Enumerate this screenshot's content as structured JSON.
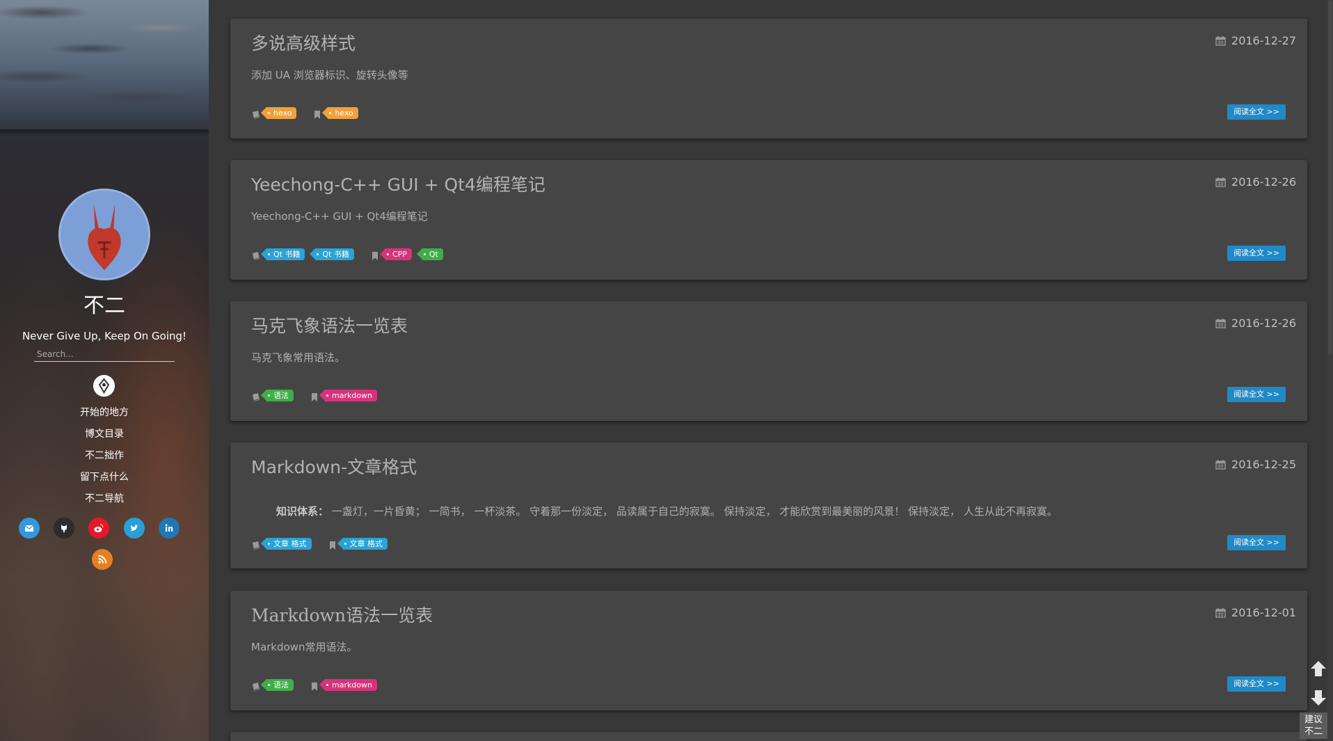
{
  "site": {
    "name": "不二",
    "motto": "Never Give Up, Keep On Going!",
    "search_placeholder": "Search..."
  },
  "nav": {
    "items": [
      {
        "label": "开始的地方"
      },
      {
        "label": "博文目录"
      },
      {
        "label": "不二拙作"
      },
      {
        "label": "留下点什么"
      },
      {
        "label": "不二导航"
      }
    ]
  },
  "social": [
    {
      "icon": "mail-icon",
      "color": "#3498db"
    },
    {
      "icon": "github-icon",
      "color": "#2c2c2c"
    },
    {
      "icon": "weibo-icon",
      "color": "#e6162d"
    },
    {
      "icon": "twitter-icon",
      "color": "#2a9fd6"
    },
    {
      "icon": "linkedin-icon",
      "color": "#1f78b4"
    },
    {
      "icon": "rss-icon",
      "color": "#e67e22"
    }
  ],
  "read_more_label": "阅读全文 >>",
  "posts": [
    {
      "title": "多说高级样式",
      "date": "2016-12-27",
      "excerpt": "添加 UA 浏览器标识、旋转头像等",
      "categories": [
        {
          "name": "hexo",
          "color": "#f0a03c"
        }
      ],
      "tags": [
        {
          "name": "hexo",
          "color": "#f0a03c"
        }
      ]
    },
    {
      "title": "Yeechong-C++ GUI + Qt4编程笔记",
      "date": "2016-12-26",
      "excerpt": "Yeechong-C++ GUI + Qt4编程笔记",
      "categories": [
        {
          "name": "Qt 书籍",
          "color": "#2aa3d6"
        },
        {
          "name": "Qt 书籍",
          "color": "#2aa3d6"
        }
      ],
      "tags": [
        {
          "name": "CPP",
          "color": "#d9327c"
        },
        {
          "name": "Qt",
          "color": "#3fae49"
        }
      ]
    },
    {
      "title": "马克飞象语法一览表",
      "date": "2016-12-26",
      "excerpt": "马克飞象常用语法。",
      "categories": [
        {
          "name": "语法",
          "color": "#3fae49"
        }
      ],
      "tags": [
        {
          "name": "markdown",
          "color": "#d9327c"
        }
      ]
    },
    {
      "title": "Markdown-文章格式",
      "date": "2016-12-25",
      "excerpt_label": "知识体系：",
      "excerpt": "一盏灯，一片昏黄； 一简书， 一杯淡茶。 守着那一份淡定， 品读属于自己的寂寞。 保持淡定， 才能欣赏到最美丽的风景！ 保持淡定， 人生从此不再寂寞。",
      "categories": [
        {
          "name": "文章 格式",
          "color": "#2aa3d6"
        }
      ],
      "tags": [
        {
          "name": "文章 格式",
          "color": "#2aa3d6"
        }
      ]
    },
    {
      "title": "Markdown语法一览表",
      "date": "2016-12-01",
      "excerpt": "Markdown常用语法。",
      "categories": [
        {
          "name": "语法",
          "color": "#3fae49"
        }
      ],
      "tags": [
        {
          "name": "markdown",
          "color": "#d9327c"
        }
      ]
    }
  ],
  "feedback": {
    "line1": "建议",
    "line2": "不二"
  }
}
